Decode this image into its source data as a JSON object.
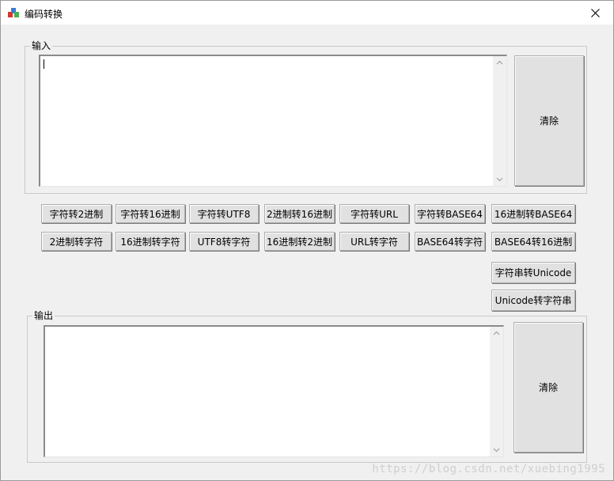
{
  "window": {
    "title": "编码转换",
    "app_icon": "app-icon",
    "close_icon": "close-icon"
  },
  "input_group": {
    "legend": "输入",
    "text_value": "",
    "clear_label": "清除"
  },
  "output_group": {
    "legend": "输出",
    "text_value": "",
    "clear_label": "清除"
  },
  "buttons": {
    "row1": [
      "字符转2进制",
      "字符转16进制",
      "字符转UTF8",
      "2进制转16进制",
      "字符转URL",
      "字符转BASE64",
      "16进制转BASE64"
    ],
    "row2": [
      "2进制转字符",
      "16进制转字符",
      "UTF8转字符",
      "16进制转2进制",
      "URL转字符",
      "BASE64转字符",
      "BASE64转16进制"
    ],
    "unicode_to": "字符串转Unicode",
    "unicode_from": "Unicode转字符串"
  },
  "watermark": "https://blog.csdn.net/xuebing1995",
  "colors": {
    "window_bg": "#f0f0f0",
    "button_bg": "#e1e1e1",
    "textarea_bg": "#ffffff"
  }
}
